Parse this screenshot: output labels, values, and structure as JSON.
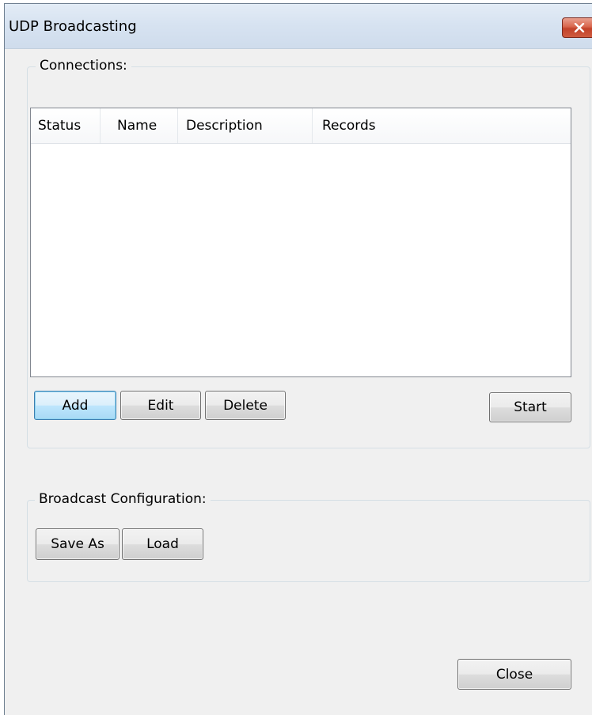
{
  "window": {
    "title": "UDP Broadcasting",
    "close_glyph": "✕",
    "accent_close_color": "#c2422a"
  },
  "connections": {
    "legend": "Connections:",
    "columns": [
      "Status",
      "Name",
      "Description",
      "Records"
    ],
    "rows": [],
    "buttons": {
      "add": "Add",
      "edit": "Edit",
      "delete": "Delete",
      "start": "Start"
    }
  },
  "broadcast_config": {
    "legend": "Broadcast Configuration:",
    "buttons": {
      "save_as": "Save As",
      "load": "Load"
    }
  },
  "footer": {
    "close": "Close"
  }
}
